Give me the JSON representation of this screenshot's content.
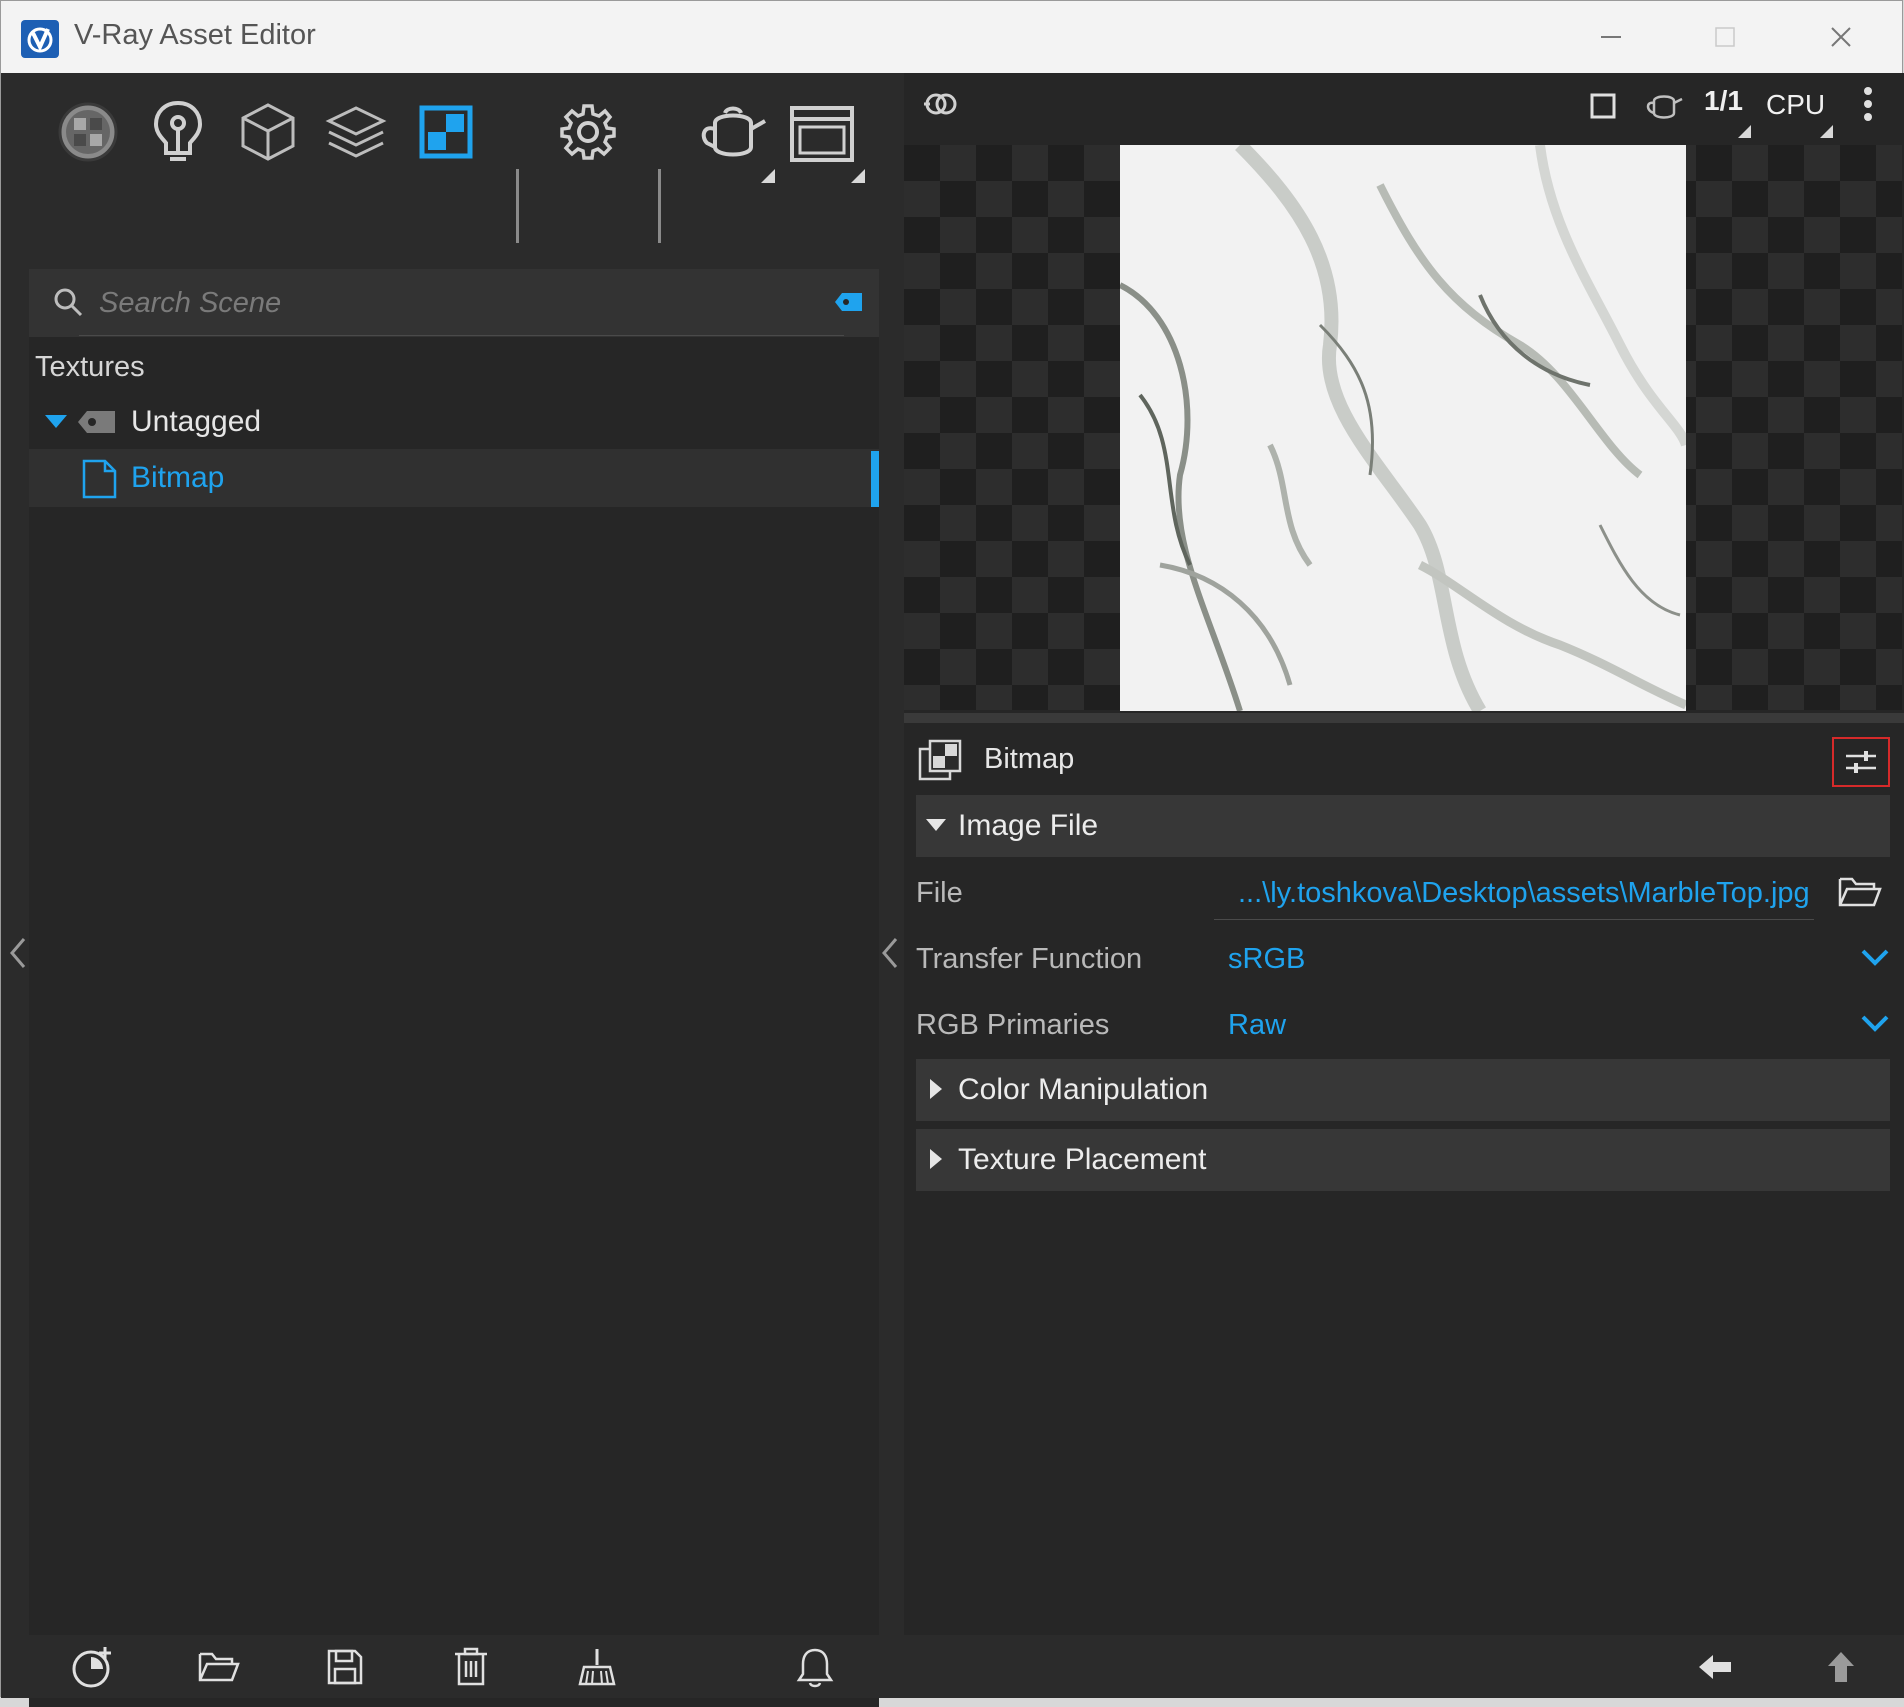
{
  "window": {
    "title": "V-Ray Asset Editor"
  },
  "toolbar": {
    "icons": [
      "materials-icon",
      "lights-icon",
      "geometry-icon",
      "render-elements-icon",
      "textures-icon",
      "settings-icon",
      "render-interactive-icon",
      "frame-buffer-icon"
    ]
  },
  "search": {
    "placeholder": "Search Scene"
  },
  "tree": {
    "section": "Textures",
    "group": "Untagged",
    "items": [
      {
        "label": "Bitmap"
      }
    ]
  },
  "preview": {
    "engine": "CPU",
    "ratio_num": "1",
    "ratio_den": "1"
  },
  "asset": {
    "title": "Bitmap",
    "rollouts": {
      "image_file": "Image File",
      "color_manipulation": "Color Manipulation",
      "texture_placement": "Texture Placement"
    },
    "props": {
      "file_label": "File",
      "file_value": "...\\ly.toshkova\\Desktop\\assets\\MarbleTop.jpg",
      "transfer_label": "Transfer Function",
      "transfer_value": "sRGB",
      "primaries_label": "RGB Primaries",
      "primaries_value": "Raw"
    }
  },
  "colors": {
    "accent": "#1fa3ee",
    "highlight_border": "#d62a2a",
    "background": "#262626"
  }
}
